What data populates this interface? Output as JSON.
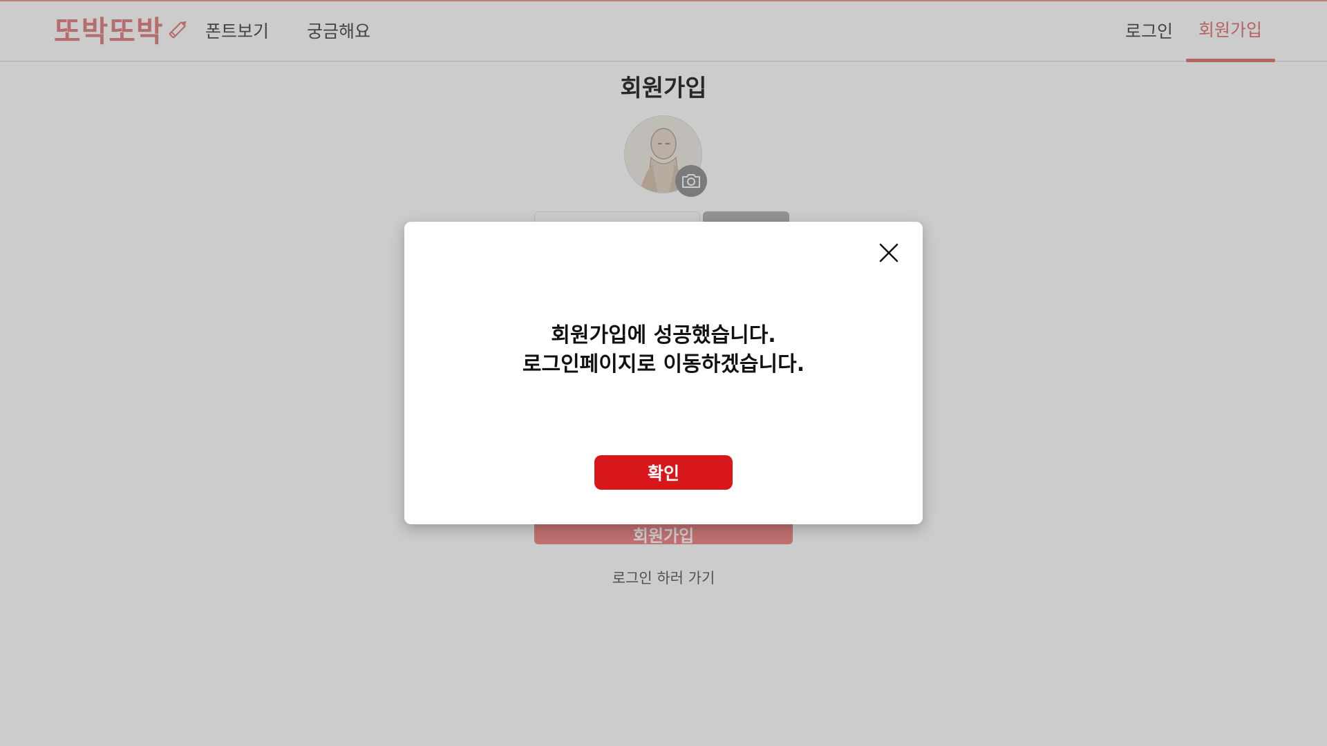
{
  "header": {
    "logo_text": "또박또박",
    "nav": {
      "fonts_label": "폰트보기",
      "faq_label": "궁금해요",
      "login_label": "로그인",
      "signup_label": "회원가입"
    }
  },
  "main": {
    "title": "회원가입",
    "submit_label": "회원가입",
    "go_login_label": "로그인 하러 가기"
  },
  "modal": {
    "message_line1": "회원가입에 성공했습니다.",
    "message_line2": "로그인페이지로 이동하겠습니다.",
    "confirm_label": "확인"
  },
  "colors": {
    "brand_pink": "#e37e7e",
    "confirm_red": "#d8171b",
    "overlay": "rgba(0,0,0,0.2)"
  },
  "icons": {
    "logo": "pencil-icon",
    "avatar_upload": "camera-icon",
    "modal_close": "close-icon"
  }
}
